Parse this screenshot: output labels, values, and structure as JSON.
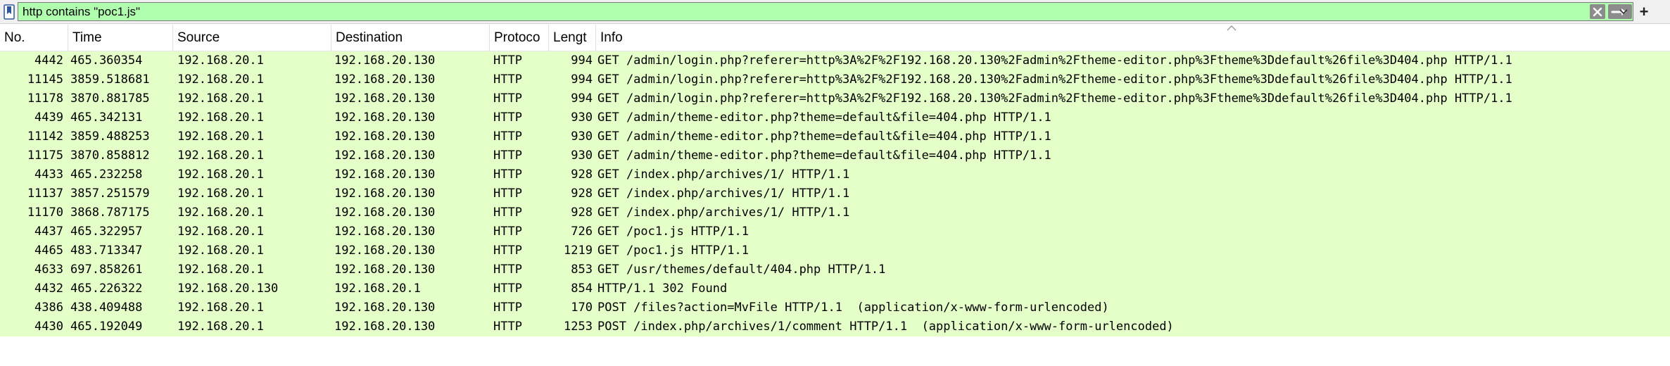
{
  "filter": {
    "value": "http contains \"poc1.js\"",
    "bg_color": "#afffaf"
  },
  "icons": {
    "bookmark": "bookmark-icon",
    "clear": "clear-x-icon",
    "apply": "apply-arrow-icon",
    "dropdown": "chevron-down-icon",
    "add": "plus-icon",
    "sort": "sort-ascending-icon"
  },
  "add_label": "+",
  "columns": [
    "No.",
    "Time",
    "Source",
    "Destination",
    "Protoco",
    "Lengt",
    "Info"
  ],
  "row_color": "#e4ffc7",
  "packets": [
    {
      "no": "4442",
      "time": "465.360354",
      "source": "192.168.20.1",
      "destination": "192.168.20.130",
      "protocol": "HTTP",
      "length": "994",
      "info": "GET /admin/login.php?referer=http%3A%2F%2F192.168.20.130%2Fadmin%2Ftheme-editor.php%3Ftheme%3Ddefault%26file%3D404.php HTTP/1.1"
    },
    {
      "no": "11145",
      "time": "3859.518681",
      "source": "192.168.20.1",
      "destination": "192.168.20.130",
      "protocol": "HTTP",
      "length": "994",
      "info": "GET /admin/login.php?referer=http%3A%2F%2F192.168.20.130%2Fadmin%2Ftheme-editor.php%3Ftheme%3Ddefault%26file%3D404.php HTTP/1.1"
    },
    {
      "no": "11178",
      "time": "3870.881785",
      "source": "192.168.20.1",
      "destination": "192.168.20.130",
      "protocol": "HTTP",
      "length": "994",
      "info": "GET /admin/login.php?referer=http%3A%2F%2F192.168.20.130%2Fadmin%2Ftheme-editor.php%3Ftheme%3Ddefault%26file%3D404.php HTTP/1.1"
    },
    {
      "no": "4439",
      "time": "465.342131",
      "source": "192.168.20.1",
      "destination": "192.168.20.130",
      "protocol": "HTTP",
      "length": "930",
      "info": "GET /admin/theme-editor.php?theme=default&file=404.php HTTP/1.1"
    },
    {
      "no": "11142",
      "time": "3859.488253",
      "source": "192.168.20.1",
      "destination": "192.168.20.130",
      "protocol": "HTTP",
      "length": "930",
      "info": "GET /admin/theme-editor.php?theme=default&file=404.php HTTP/1.1"
    },
    {
      "no": "11175",
      "time": "3870.858812",
      "source": "192.168.20.1",
      "destination": "192.168.20.130",
      "protocol": "HTTP",
      "length": "930",
      "info": "GET /admin/theme-editor.php?theme=default&file=404.php HTTP/1.1"
    },
    {
      "no": "4433",
      "time": "465.232258",
      "source": "192.168.20.1",
      "destination": "192.168.20.130",
      "protocol": "HTTP",
      "length": "928",
      "info": "GET /index.php/archives/1/ HTTP/1.1"
    },
    {
      "no": "11137",
      "time": "3857.251579",
      "source": "192.168.20.1",
      "destination": "192.168.20.130",
      "protocol": "HTTP",
      "length": "928",
      "info": "GET /index.php/archives/1/ HTTP/1.1"
    },
    {
      "no": "11170",
      "time": "3868.787175",
      "source": "192.168.20.1",
      "destination": "192.168.20.130",
      "protocol": "HTTP",
      "length": "928",
      "info": "GET /index.php/archives/1/ HTTP/1.1"
    },
    {
      "no": "4437",
      "time": "465.322957",
      "source": "192.168.20.1",
      "destination": "192.168.20.130",
      "protocol": "HTTP",
      "length": "726",
      "info": "GET /poc1.js HTTP/1.1"
    },
    {
      "no": "4465",
      "time": "483.713347",
      "source": "192.168.20.1",
      "destination": "192.168.20.130",
      "protocol": "HTTP",
      "length": "1219",
      "info": "GET /poc1.js HTTP/1.1"
    },
    {
      "no": "4633",
      "time": "697.858261",
      "source": "192.168.20.1",
      "destination": "192.168.20.130",
      "protocol": "HTTP",
      "length": "853",
      "info": "GET /usr/themes/default/404.php HTTP/1.1"
    },
    {
      "no": "4432",
      "time": "465.226322",
      "source": "192.168.20.130",
      "destination": "192.168.20.1",
      "protocol": "HTTP",
      "length": "854",
      "info": "HTTP/1.1 302 Found"
    },
    {
      "no": "4386",
      "time": "438.409488",
      "source": "192.168.20.1",
      "destination": "192.168.20.130",
      "protocol": "HTTP",
      "length": "170",
      "info": "POST /files?action=MvFile HTTP/1.1  (application/x-www-form-urlencoded)"
    },
    {
      "no": "4430",
      "time": "465.192049",
      "source": "192.168.20.1",
      "destination": "192.168.20.130",
      "protocol": "HTTP",
      "length": "1253",
      "info": "POST /index.php/archives/1/comment HTTP/1.1  (application/x-www-form-urlencoded)"
    }
  ]
}
